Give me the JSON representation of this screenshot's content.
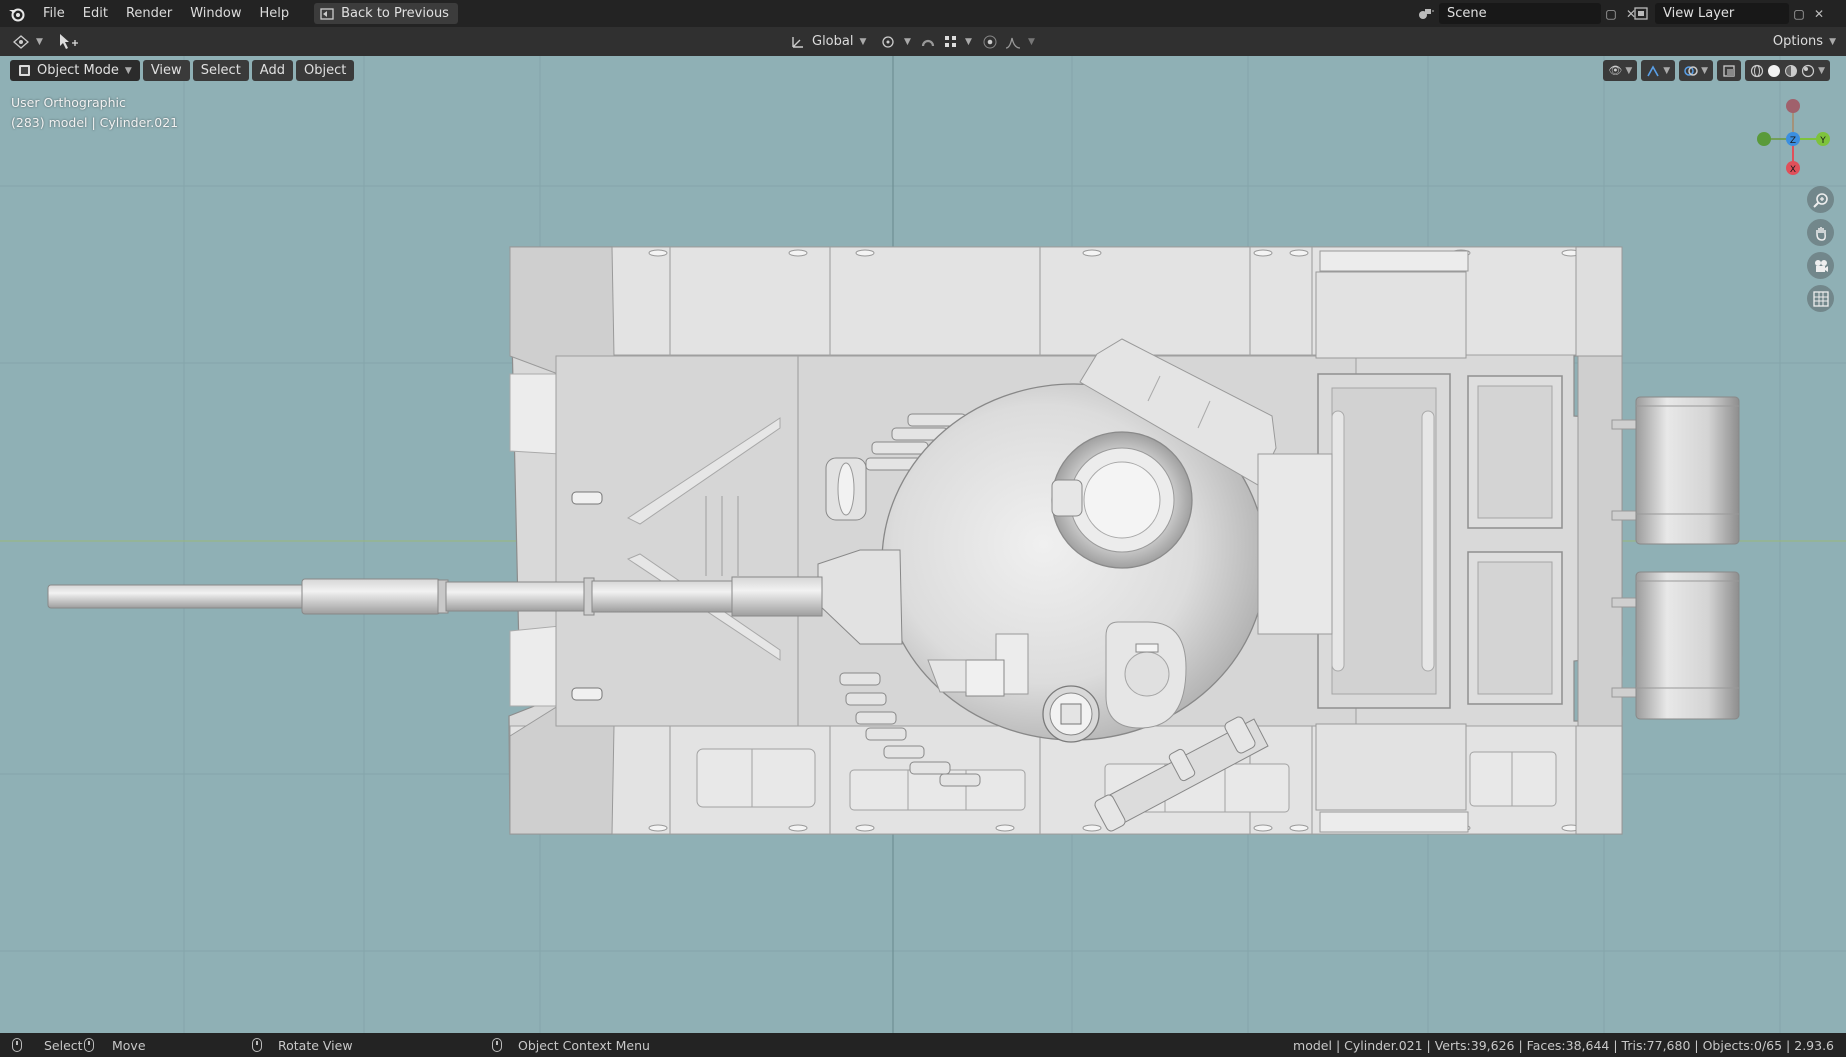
{
  "menu": {
    "items": [
      "File",
      "Edit",
      "Render",
      "Window",
      "Help"
    ],
    "back_label": "Back to Previous"
  },
  "workspace": {
    "scene_label": "Scene",
    "view_layer_label": "View Layer"
  },
  "toolbar": {
    "transform_orientation": "Global",
    "options_label": "Options"
  },
  "viewport_header": {
    "mode": "Object Mode",
    "view": "View",
    "select": "Select",
    "add": "Add",
    "object": "Object"
  },
  "overlay": {
    "view_name": "User Orthographic",
    "object_info": "(283) model | Cylinder.021"
  },
  "gizmo": {
    "z": "Z",
    "y": "Y",
    "x": "X"
  },
  "status": {
    "select": "Select",
    "move": "Move",
    "rotate": "Rotate View",
    "context": "Object Context Menu",
    "stats": "model | Cylinder.021 | Verts:39,626 | Faces:38,644 | Tris:77,680 | Objects:0/65 | 2.93.6"
  },
  "colors": {
    "viewport_bg": "#8fb0b5",
    "axis_x": "#e0505a",
    "axis_y": "#7ec33c",
    "axis_z": "#3b8fe0"
  }
}
